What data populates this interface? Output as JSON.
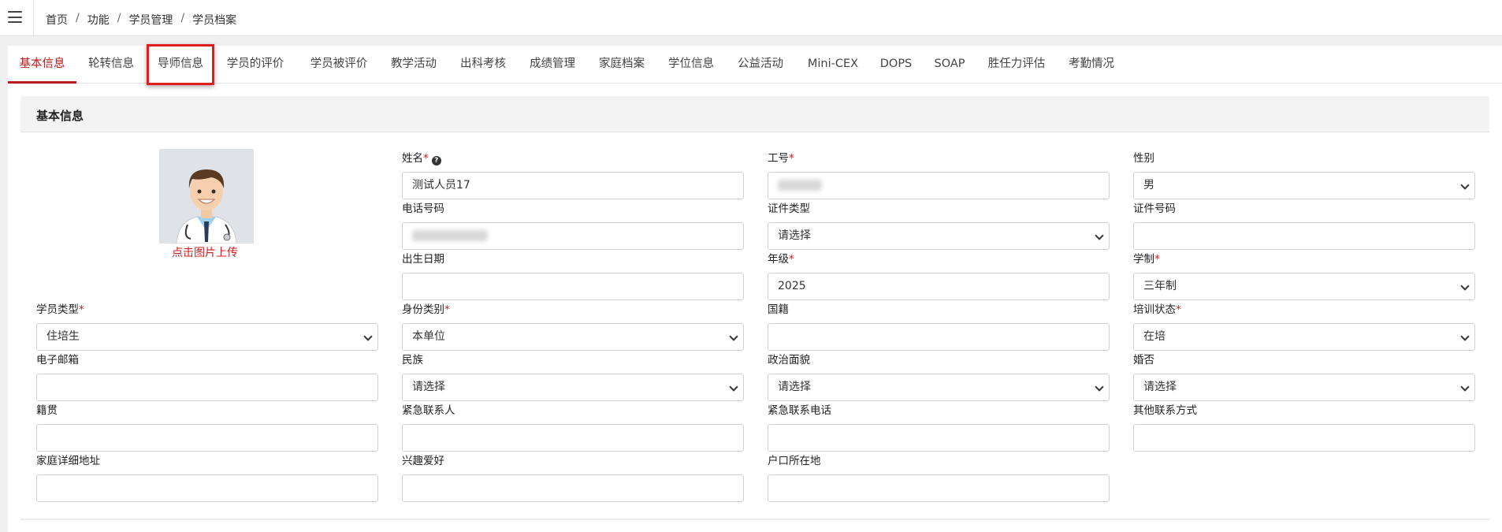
{
  "breadcrumb": [
    "首页",
    "功能",
    "学员管理",
    "学员档案"
  ],
  "tabs": [
    "基本信息",
    "轮转信息",
    "导师信息",
    "学员的评价",
    "学员被评价",
    "教学活动",
    "出科考核",
    "成绩管理",
    "家庭档案",
    "学位信息",
    "公益活动",
    "Mini-CEX",
    "DOPS",
    "SOAP",
    "胜任力评估",
    "考勤情况"
  ],
  "active_tab": "基本信息",
  "section_title": "基本信息",
  "upload_text": "点击图片上传",
  "fields": {
    "name": {
      "label": "姓名",
      "required": true,
      "value": "测试人员17"
    },
    "staff_no": {
      "label": "工号",
      "required": true,
      "value": ""
    },
    "gender": {
      "label": "性别",
      "value": "男"
    },
    "phone": {
      "label": "电话号码",
      "value": ""
    },
    "id_type": {
      "label": "证件类型",
      "value": "请选择"
    },
    "id_number": {
      "label": "证件号码",
      "value": ""
    },
    "birth_date": {
      "label": "出生日期",
      "value": ""
    },
    "grade": {
      "label": "年级",
      "required": true,
      "value": "2025"
    },
    "program_length": {
      "label": "学制",
      "required": true,
      "value": "三年制"
    },
    "student_type": {
      "label": "学员类型",
      "required": true,
      "value": "住培生"
    },
    "identity_category": {
      "label": "身份类别",
      "required": true,
      "value": "本单位"
    },
    "nationality": {
      "label": "国籍",
      "value": ""
    },
    "training_status": {
      "label": "培训状态",
      "required": true,
      "value": "在培"
    },
    "email": {
      "label": "电子邮箱",
      "value": ""
    },
    "ethnicity": {
      "label": "民族",
      "value": "请选择"
    },
    "political_status": {
      "label": "政治面貌",
      "value": "请选择"
    },
    "marital_status": {
      "label": "婚否",
      "value": "请选择"
    },
    "native_place": {
      "label": "籍贯",
      "value": ""
    },
    "emergency_contact": {
      "label": "紧急联系人",
      "value": ""
    },
    "emergency_phone": {
      "label": "紧急联系电话",
      "value": ""
    },
    "other_contact": {
      "label": "其他联系方式",
      "value": ""
    },
    "home_address": {
      "label": "家庭详细地址",
      "value": ""
    },
    "hobbies": {
      "label": "兴趣爱好",
      "value": ""
    },
    "household_location": {
      "label": "户口所在地",
      "value": ""
    }
  },
  "colors": {
    "accent": "#b71c1c",
    "required": "#d01c1c",
    "highlight": "#e11d1d"
  }
}
